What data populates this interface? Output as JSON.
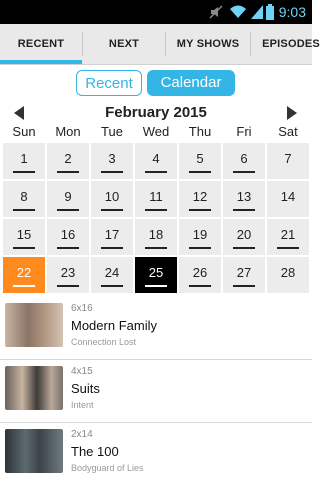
{
  "status": {
    "time": "9:03"
  },
  "tabs": [
    {
      "label": "RECENT"
    },
    {
      "label": "NEXT"
    },
    {
      "label": "MY SHOWS"
    },
    {
      "label": "EPISODES"
    }
  ],
  "segment": {
    "recent": "Recent",
    "calendar": "Calendar"
  },
  "calendar": {
    "month": "February 2015",
    "weekdays": [
      "Sun",
      "Mon",
      "Tue",
      "Wed",
      "Thu",
      "Fri",
      "Sat"
    ],
    "days": [
      "1",
      "2",
      "3",
      "4",
      "5",
      "6",
      "7",
      "8",
      "9",
      "10",
      "11",
      "12",
      "13",
      "14",
      "15",
      "16",
      "17",
      "18",
      "19",
      "20",
      "21",
      "22",
      "23",
      "24",
      "25",
      "26",
      "27",
      "28"
    ]
  },
  "shows": [
    {
      "episode": "6x16",
      "title": "Modern Family",
      "subtitle": "Connection Lost"
    },
    {
      "episode": "4x15",
      "title": "Suits",
      "subtitle": "Intent"
    },
    {
      "episode": "2x14",
      "title": "The 100",
      "subtitle": "Bodyguard of Lies"
    }
  ]
}
